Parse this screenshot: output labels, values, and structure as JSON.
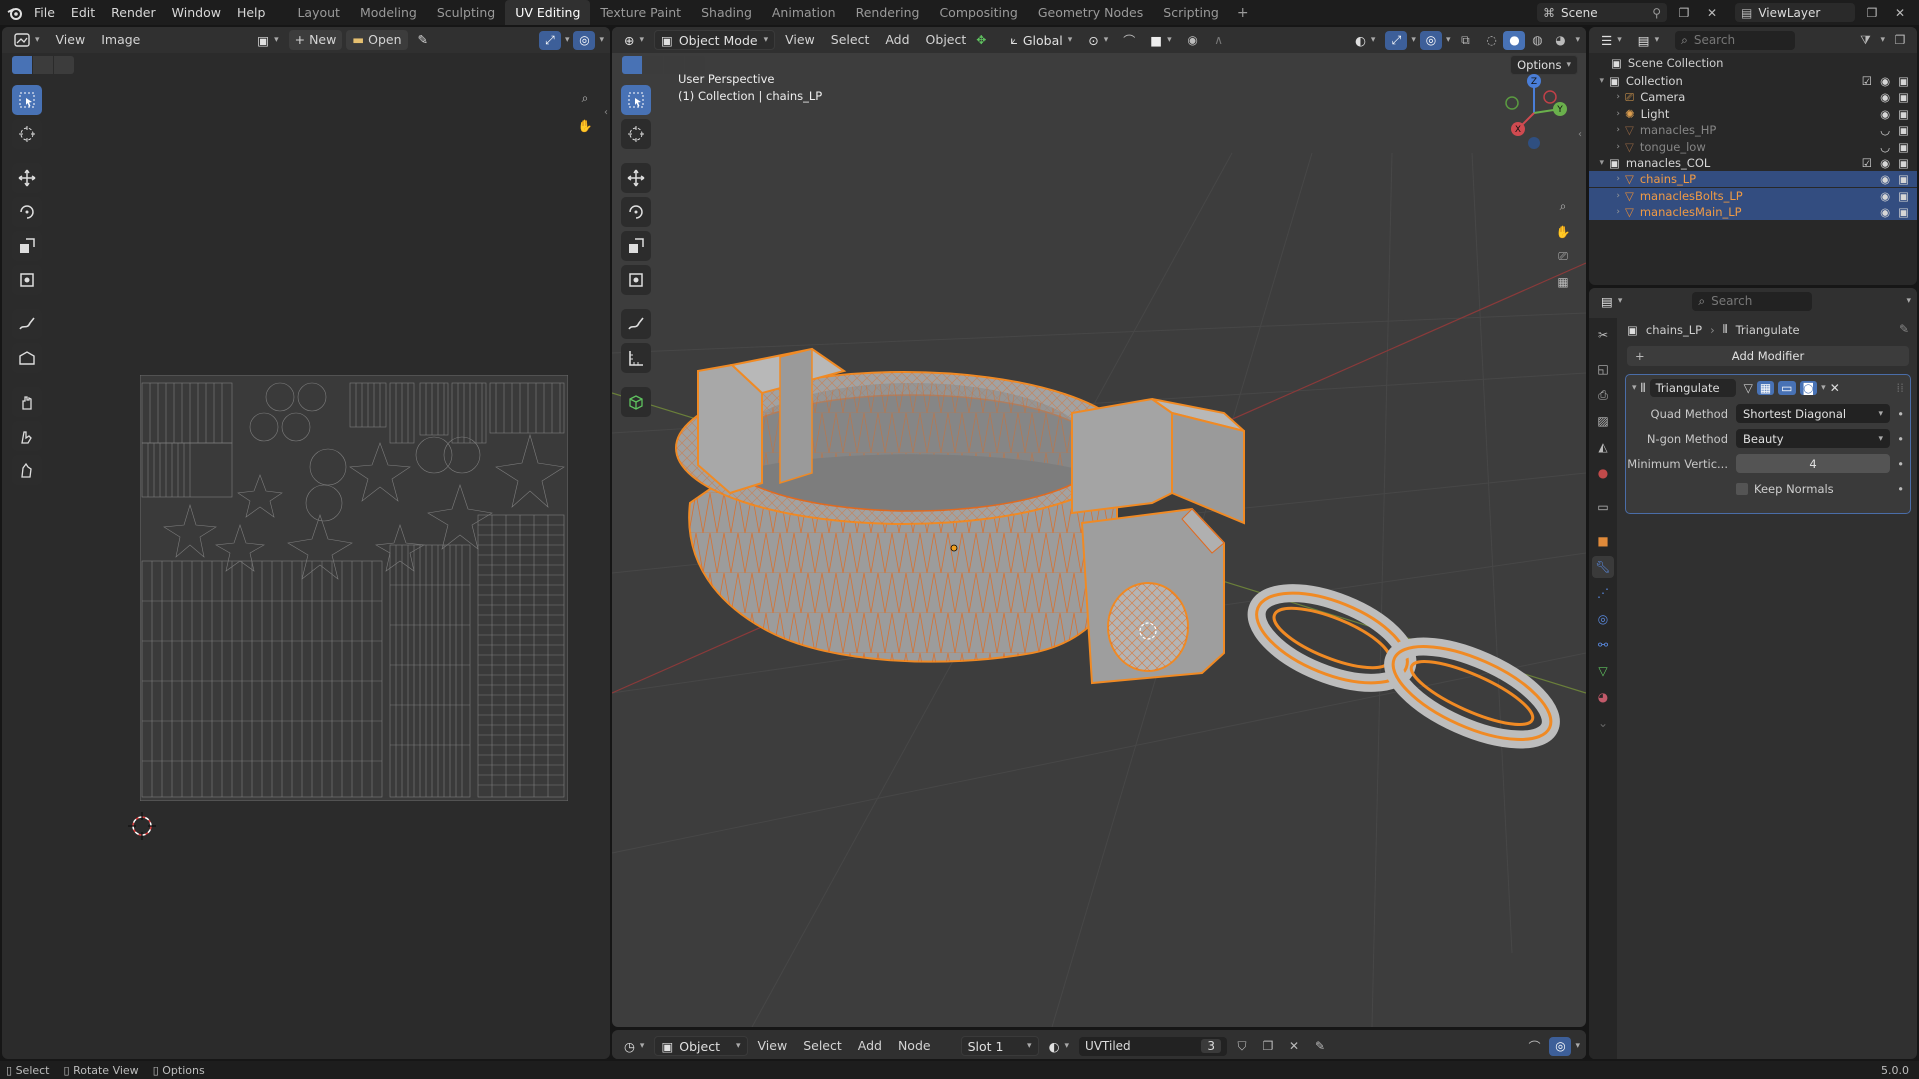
{
  "menu": {
    "file": "File",
    "edit": "Edit",
    "render": "Render",
    "window": "Window",
    "help": "Help"
  },
  "workspaces": [
    {
      "label": "Layout",
      "active": false
    },
    {
      "label": "Modeling",
      "active": false
    },
    {
      "label": "Sculpting",
      "active": false
    },
    {
      "label": "UV Editing",
      "active": true
    },
    {
      "label": "Texture Paint",
      "active": false
    },
    {
      "label": "Shading",
      "active": false
    },
    {
      "label": "Animation",
      "active": false
    },
    {
      "label": "Rendering",
      "active": false
    },
    {
      "label": "Compositing",
      "active": false
    },
    {
      "label": "Geometry Nodes",
      "active": false
    },
    {
      "label": "Scripting",
      "active": false
    }
  ],
  "scene_name": "Scene",
  "view_layer": "ViewLayer",
  "uv_editor": {
    "view": "View",
    "image": "Image",
    "new": "New",
    "open": "Open"
  },
  "viewport": {
    "mode": "Object Mode",
    "view": "View",
    "select": "Select",
    "add": "Add",
    "object": "Object",
    "orientation": "Global",
    "options": "Options",
    "overlay_line1": "User Perspective",
    "overlay_line2": "(1) Collection | chains_LP"
  },
  "node_header": {
    "type": "Object",
    "view": "View",
    "select": "Select",
    "add": "Add",
    "node": "Node",
    "slot": "Slot 1",
    "material": "UVTiled",
    "users": "3"
  },
  "outliner": {
    "search_placeholder": "Search",
    "scene_collection": "Scene Collection",
    "rows": [
      {
        "label": "Collection",
        "indent": 1,
        "type": "collection",
        "sel": false,
        "dim": false
      },
      {
        "label": "Camera",
        "indent": 2,
        "type": "camera",
        "sel": false,
        "dim": false
      },
      {
        "label": "Light",
        "indent": 2,
        "type": "light",
        "sel": false,
        "dim": false
      },
      {
        "label": "manacles_HP",
        "indent": 2,
        "type": "mesh",
        "sel": false,
        "dim": true
      },
      {
        "label": "tongue_low",
        "indent": 2,
        "type": "mesh",
        "sel": false,
        "dim": true
      },
      {
        "label": "manacles_COL",
        "indent": 1,
        "type": "collection",
        "sel": false,
        "dim": false
      },
      {
        "label": "chains_LP",
        "indent": 2,
        "type": "mesh",
        "sel": true,
        "dim": false
      },
      {
        "label": "manaclesBolts_LP",
        "indent": 2,
        "type": "mesh",
        "sel": true,
        "dim": false
      },
      {
        "label": "manaclesMain_LP",
        "indent": 2,
        "type": "mesh",
        "sel": true,
        "dim": false
      }
    ]
  },
  "properties": {
    "search_placeholder": "Search",
    "breadcrumb_object": "chains_LP",
    "breadcrumb_modifier": "Triangulate",
    "add_modifier": "Add Modifier",
    "modifier_name": "Triangulate",
    "quad_method_label": "Quad Method",
    "quad_method_value": "Shortest Diagonal",
    "ngon_method_label": "N-gon Method",
    "ngon_method_value": "Beauty",
    "min_vert_label": "Minimum Vertic...",
    "min_vert_value": "4",
    "keep_normals_label": "Keep Normals"
  },
  "status": {
    "select": "Select",
    "rotate": "Rotate View",
    "options": "Options",
    "version": "5.0.0"
  },
  "colors": {
    "accent": "#4872b5",
    "selection_orange": "#f08a24",
    "selected_row": "#334d80"
  }
}
